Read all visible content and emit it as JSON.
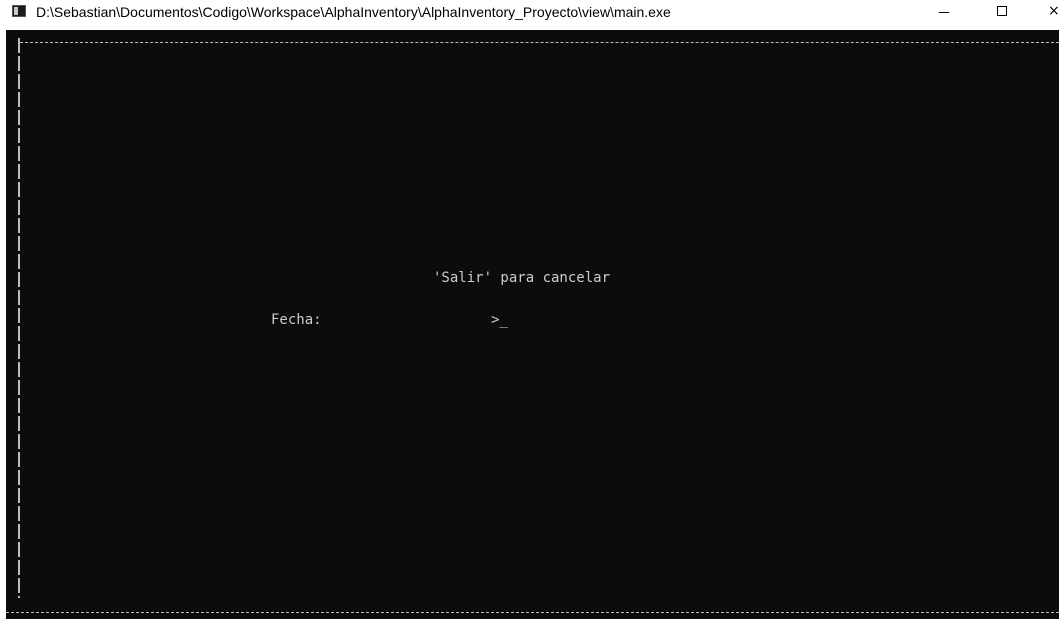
{
  "window": {
    "title": "D:\\Sebastian\\Documentos\\Codigo\\Workspace\\AlphaInventory\\AlphaInventory_Proyecto\\view\\main.exe",
    "controls": {
      "minimize_glyph": "–",
      "maximize_glyph": "☐",
      "close_glyph": "×"
    }
  },
  "console": {
    "hint": "'Salir' para cancelar",
    "field_label": "Fecha:",
    "prompt": ">_"
  },
  "colors": {
    "console_background": "#0c0c0c",
    "console_text": "#cccccc",
    "titlebar_background": "#ffffff"
  },
  "icons": [
    "console-app-icon",
    "minimize-icon",
    "maximize-icon",
    "close-icon"
  ]
}
